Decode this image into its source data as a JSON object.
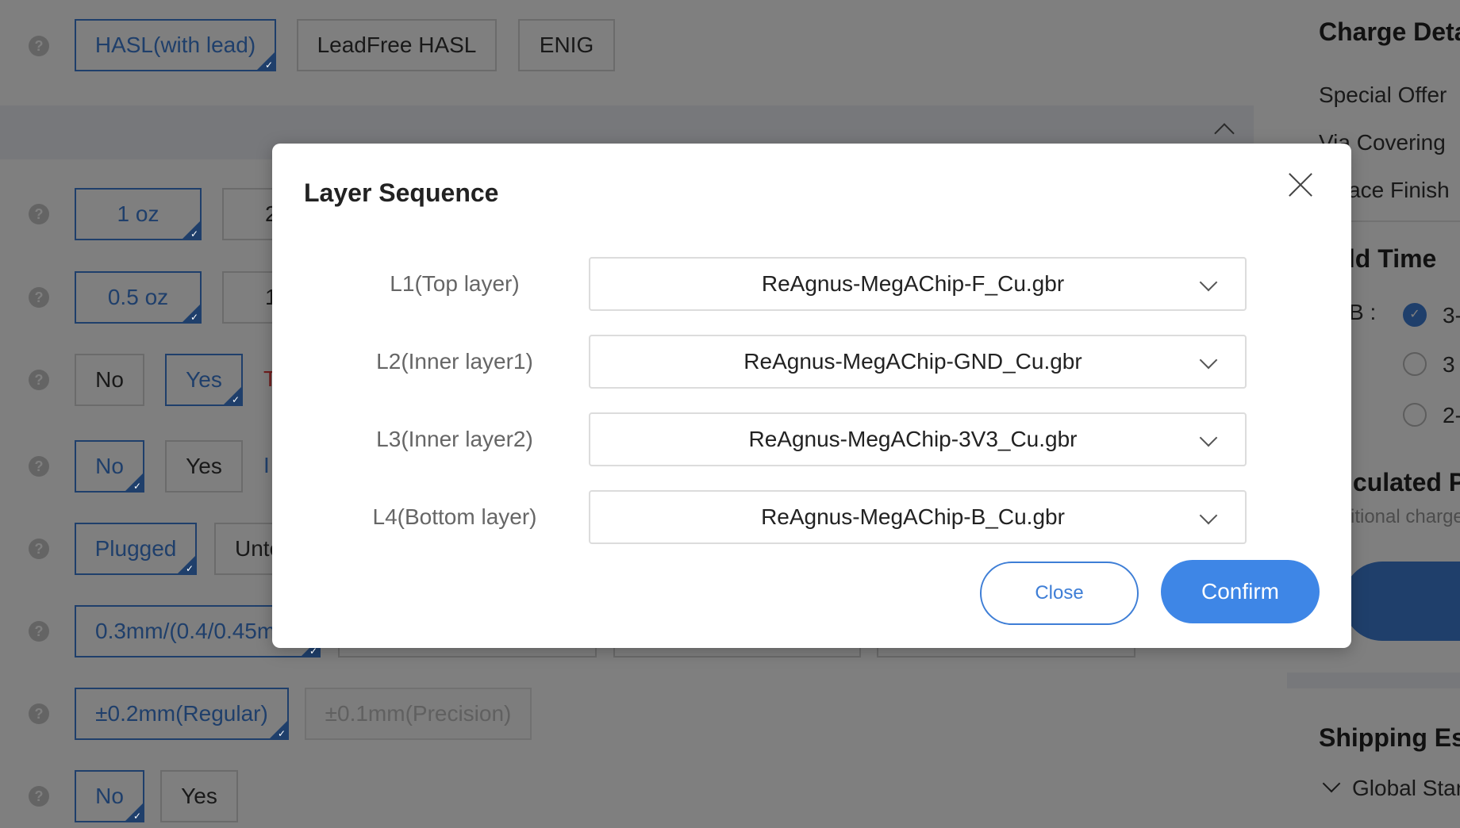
{
  "background": {
    "surface_finish": {
      "options": [
        "HASL(with lead)",
        "LeadFree HASL",
        "ENIG"
      ]
    },
    "copper_outer": {
      "options": [
        "1 oz",
        "2"
      ]
    },
    "copper_inner": {
      "options": [
        "0.5 oz",
        "1"
      ]
    },
    "row_yes_no_1": {
      "options": [
        "No",
        "Yes"
      ],
      "note": "T"
    },
    "row_yes_no_2": {
      "options": [
        "No",
        "Yes"
      ],
      "note": "I"
    },
    "via_covering": {
      "options": [
        "Plugged",
        "Unte"
      ]
    },
    "min_via": {
      "options": [
        "0.3mm/(0.4/0.45m"
      ]
    },
    "tolerance": {
      "options": [
        "±0.2mm(Regular)",
        "±0.1mm(Precision)"
      ]
    },
    "last_row": {
      "options": [
        "No",
        "Yes"
      ]
    },
    "help_glyph": "?",
    "tick_glyph": "✓"
  },
  "right_panel": {
    "charge_title": "Charge Deta",
    "special_offer": "Special Offer",
    "via_covering": "Via Covering",
    "surface_finish": "rface Finish",
    "build_time_title": "ild Time",
    "pcb_label": "B :",
    "radio_options": [
      "3-",
      "3",
      "2-"
    ],
    "calculated_title": "lculated P",
    "additional_charge": "itional charge",
    "shipping_title": "Shipping Es",
    "global_standard": "Global Star"
  },
  "modal": {
    "title": "Layer Sequence",
    "layers": [
      {
        "label": "L1(Top layer)",
        "value": "ReAgnus-MegAChip-F_Cu.gbr"
      },
      {
        "label": "L2(Inner layer1)",
        "value": "ReAgnus-MegAChip-GND_Cu.gbr"
      },
      {
        "label": "L3(Inner layer2)",
        "value": "ReAgnus-MegAChip-3V3_Cu.gbr"
      },
      {
        "label": "L4(Bottom layer)",
        "value": "ReAgnus-MegAChip-B_Cu.gbr"
      }
    ],
    "close_label": "Close",
    "confirm_label": "Confirm"
  },
  "colors": {
    "accent": "#3e7ed6",
    "confirm": "#3e86e6",
    "overlay": "rgba(0,0,0,0.5)"
  }
}
